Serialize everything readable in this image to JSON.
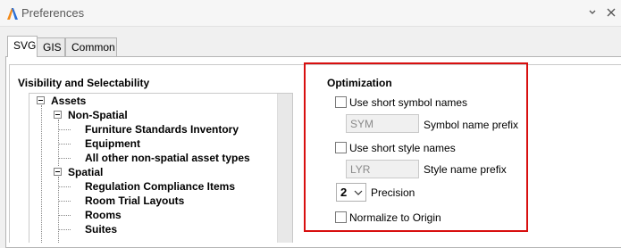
{
  "window": {
    "title": "Preferences",
    "help_icon": "chevron-down-icon",
    "close_icon": "close-icon"
  },
  "tabs": [
    {
      "label": "SVG",
      "active": true
    },
    {
      "label": "GIS",
      "active": false
    },
    {
      "label": "Common",
      "active": false
    }
  ],
  "visibility": {
    "heading": "Visibility and Selectability",
    "tree": [
      {
        "label": "Assets",
        "level": 0,
        "expanded": true
      },
      {
        "label": "Non-Spatial",
        "level": 1,
        "expanded": true
      },
      {
        "label": "Furniture Standards Inventory",
        "level": 2
      },
      {
        "label": "Equipment",
        "level": 2
      },
      {
        "label": "All other non-spatial asset types",
        "level": 2
      },
      {
        "label": "Spatial",
        "level": 1,
        "expanded": true
      },
      {
        "label": "Regulation Compliance Items",
        "level": 2
      },
      {
        "label": "Room Trial Layouts",
        "level": 2
      },
      {
        "label": "Rooms",
        "level": 2
      },
      {
        "label": "Suites",
        "level": 2
      }
    ]
  },
  "optimization": {
    "heading": "Optimization",
    "short_symbol": {
      "label": "Use short symbol names",
      "checked": false
    },
    "symbol_prefix": {
      "value": "SYM",
      "label": "Symbol name prefix"
    },
    "short_style": {
      "label": "Use short style names",
      "checked": false
    },
    "style_prefix": {
      "value": "LYR",
      "label": "Style name prefix"
    },
    "precision": {
      "value": "2",
      "label": "Precision"
    },
    "normalize": {
      "label": "Normalize to Origin",
      "checked": false
    }
  },
  "colors": {
    "highlight_border": "#d80f0f",
    "app_icon_orange": "#f28a1a",
    "app_icon_blue": "#2a6fd6"
  }
}
